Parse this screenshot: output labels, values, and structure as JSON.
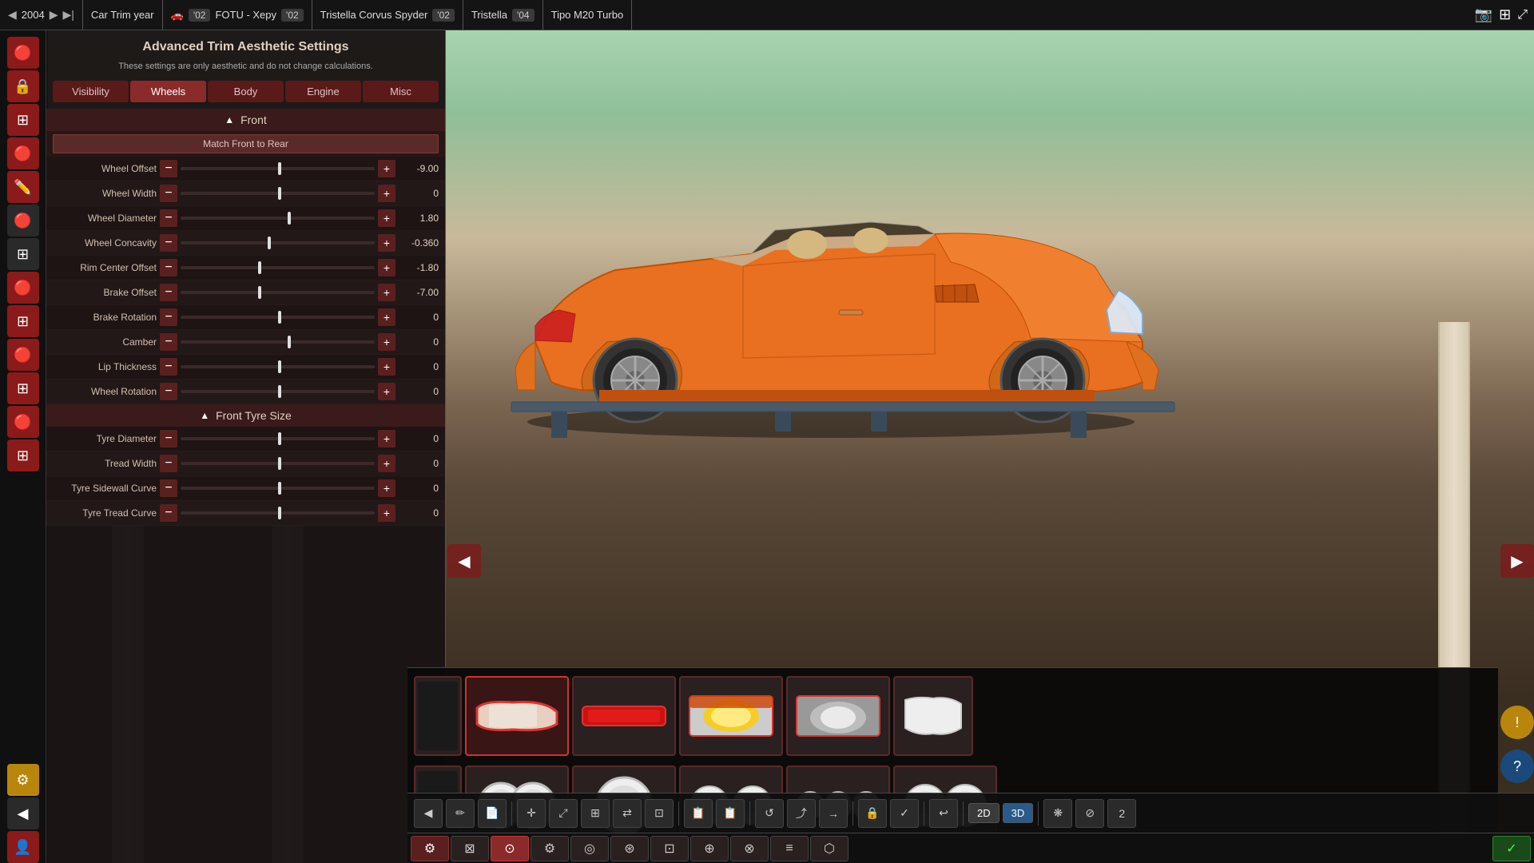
{
  "topbar": {
    "year_label": "Car Trim year",
    "year_value": "2004",
    "cars": [
      {
        "name": "FOTU - Xepy",
        "year": "'02"
      },
      {
        "name": "Tristella Corvus Spyder",
        "year": "'02"
      },
      {
        "name": "Tristella",
        "year": "'04"
      },
      {
        "name": "Tipo M20 Turbo",
        "year": ""
      }
    ]
  },
  "panel": {
    "title": "Advanced Trim Aesthetic Settings",
    "subtitle": "These settings are only aesthetic and do not change calculations.",
    "tabs": [
      "Visibility",
      "Wheels",
      "Body",
      "Engine",
      "Misc"
    ],
    "active_tab": "Wheels",
    "front_label": "Front",
    "match_label": "Match Front to Rear",
    "sliders": [
      {
        "label": "Wheel Offset",
        "value": "-9.00",
        "thumb_pos": "50"
      },
      {
        "label": "Wheel Width",
        "value": "0",
        "thumb_pos": "50"
      },
      {
        "label": "Wheel Diameter",
        "value": "1.80",
        "thumb_pos": "55"
      },
      {
        "label": "Wheel Concavity",
        "value": "-0.360",
        "thumb_pos": "45"
      },
      {
        "label": "Rim Center Offset",
        "value": "-1.80",
        "thumb_pos": "40"
      },
      {
        "label": "Brake Offset",
        "value": "-7.00",
        "thumb_pos": "42"
      },
      {
        "label": "Brake Rotation",
        "value": "0",
        "thumb_pos": "50"
      },
      {
        "label": "Camber",
        "value": "0",
        "thumb_pos": "55"
      },
      {
        "label": "Lip Thickness",
        "value": "0",
        "thumb_pos": "50"
      },
      {
        "label": "Wheel Rotation",
        "value": "0",
        "thumb_pos": "50"
      }
    ],
    "front_tyre_label": "Front Tyre Size",
    "tyre_sliders": [
      {
        "label": "Tyre Diameter",
        "value": "0",
        "thumb_pos": "50"
      },
      {
        "label": "Tread Width",
        "value": "0",
        "thumb_pos": "50"
      },
      {
        "label": "Tyre Sidewall Curve",
        "value": "0",
        "thumb_pos": "50"
      },
      {
        "label": "Tyre Tread Curve",
        "value": "0",
        "thumb_pos": "50"
      }
    ],
    "minus_label": "−",
    "plus_label": "+"
  },
  "toolbar": {
    "view_2d": "2D",
    "view_3d": "3D"
  },
  "parts": {
    "row1_count": 6,
    "row2_count": 5
  },
  "icons": {
    "back": "◀",
    "forward": "▶",
    "skip_forward": "▶▶",
    "triangle": "▲",
    "camera": "📷",
    "gear": "⚙",
    "left_arrow": "◀",
    "right_arrow": "▶",
    "help": "?",
    "alert": "!"
  }
}
